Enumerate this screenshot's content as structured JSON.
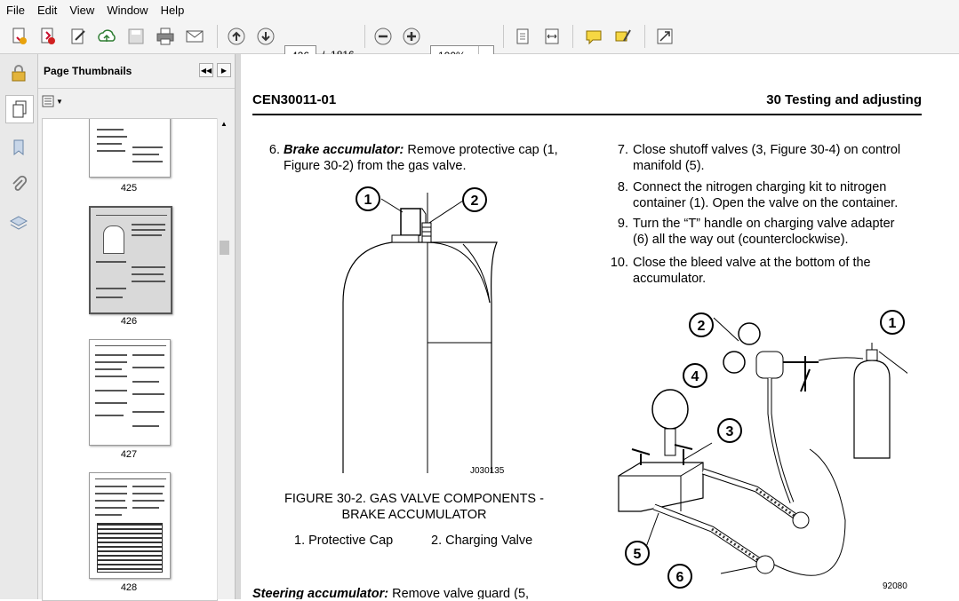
{
  "menu": [
    "File",
    "Edit",
    "View",
    "Window",
    "Help"
  ],
  "toolbar": {
    "icons": [
      "create-icon",
      "export-icon",
      "edit-icon",
      "upload-icon",
      "save-icon",
      "print-icon",
      "email-icon",
      "prev-page-icon",
      "next-page-icon",
      "zoom-out-icon",
      "zoom-in-icon",
      "fit-page-icon",
      "fit-width-icon",
      "comment-icon",
      "highlight-icon",
      "fullscreen-icon"
    ],
    "page_current": "426",
    "page_sep": "/",
    "page_total": "1816",
    "zoom": "100%"
  },
  "panel": {
    "title": "Page Thumbnails",
    "thumbnails": [
      {
        "label": "425"
      },
      {
        "label": "426"
      },
      {
        "label": "427"
      },
      {
        "label": "428"
      }
    ]
  },
  "document": {
    "header_left": "CEN30011-01",
    "header_right": "30 Testing and adjusting",
    "step6_num": "6.",
    "step6_bold": "Brake accumulator:",
    "step6_text_a": " Remove protective cap (1,",
    "step6_text_b": "Figure 30-2) from the gas valve.",
    "fig2_code": "J030135",
    "fig2_caption_1": "FIGURE 30-2. GAS VALVE COMPONENTS -",
    "fig2_caption_2": "BRAKE ACCUMULATOR",
    "fig2_legend_1": "1. Protective Cap",
    "fig2_legend_2": "2. Charging Valve",
    "partial_bold": "Steering accumulator:",
    "partial_text": " Remove valve guard (5,",
    "steps_right": [
      {
        "num": "7.",
        "l1": "Close shutoff valves (3, Figure 30-4) on control",
        "l2": "manifold (5)."
      },
      {
        "num": "8.",
        "l1": "Connect the nitrogen charging kit to nitrogen",
        "l2": "container (1). Open the valve on the container."
      },
      {
        "num": "9.",
        "l1": "Turn the “T” handle on charging valve adapter",
        "l2": "(6) all the way out (counterclockwise)."
      },
      {
        "num": "10.",
        "l1": "Close the bleed valve at the bottom of the",
        "l2": "accumulator."
      }
    ],
    "fig4_code": "92080",
    "callouts_fig2": [
      "1",
      "2"
    ],
    "callouts_fig4": [
      "1",
      "2",
      "3",
      "4",
      "5",
      "6"
    ]
  }
}
